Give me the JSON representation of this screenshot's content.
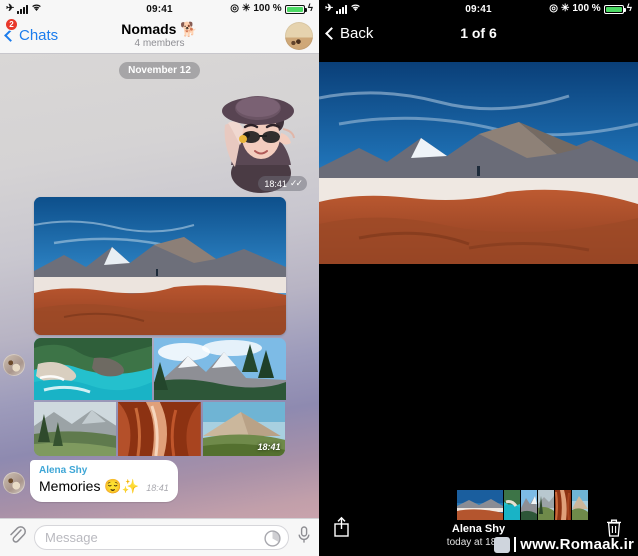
{
  "left": {
    "status_bar": {
      "time": "09:41",
      "battery_text": "100 %",
      "icons": [
        "airplane-icon",
        "signal-bars-icon",
        "wifi-icon",
        "location-icon",
        "bluetooth-icon",
        "battery-icon",
        "charging-bolt-icon"
      ]
    },
    "nav": {
      "back_label": "Chats",
      "back_badge": "2",
      "title": "Nomads 🐕",
      "subtitle": "4 members",
      "avatar_name": "group-avatar"
    },
    "chat": {
      "date_chip": "November 12",
      "sticker_time": "18:41",
      "sticker_checks": "✓✓",
      "album_time": "18:41",
      "bubble": {
        "sender": "Alena Shy",
        "text": "Memories 😌✨",
        "time": "18:41"
      }
    },
    "input": {
      "placeholder": "Message",
      "attach_icon": "paperclip-icon",
      "sticker_icon": "sticker-icon",
      "mic_icon": "microphone-icon"
    }
  },
  "right": {
    "status_bar": {
      "time": "09:41",
      "battery_text": "100 %"
    },
    "nav": {
      "back_label": "Back",
      "counter": "1 of 6"
    },
    "media": {
      "sender": "Alena Shy",
      "date": "today at 18:41",
      "share_icon": "share-icon",
      "delete_icon": "trash-icon",
      "thumb_count": 6
    }
  },
  "watermark": {
    "text": "www.Romaak.ir"
  },
  "colors": {
    "ios_blue": "#1b7ced",
    "badge_red": "#e8382b",
    "battery_green": "#4cd964",
    "sender_blue": "#3ea6d6"
  }
}
